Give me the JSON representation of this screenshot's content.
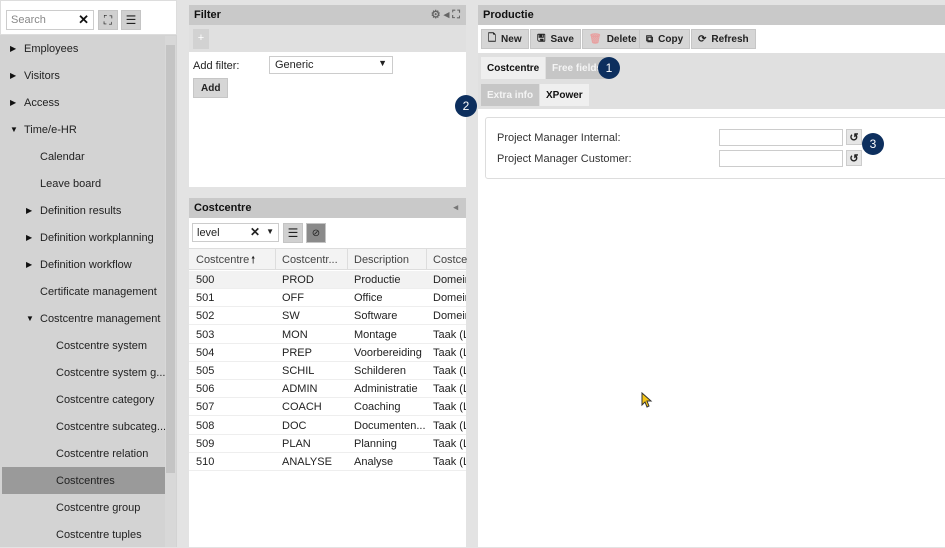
{
  "sidebar": {
    "search_placeholder": "Search",
    "items": [
      {
        "label": "Employees",
        "level": 0,
        "caret": "right"
      },
      {
        "label": "Visitors",
        "level": 0,
        "caret": "right"
      },
      {
        "label": "Access",
        "level": 0,
        "caret": "right"
      },
      {
        "label": "Time/e-HR",
        "level": 0,
        "caret": "down"
      },
      {
        "label": "Calendar",
        "level": 1,
        "caret": ""
      },
      {
        "label": "Leave board",
        "level": 1,
        "caret": ""
      },
      {
        "label": "Definition results",
        "level": 1,
        "caret": "right"
      },
      {
        "label": "Definition workplanning",
        "level": 1,
        "caret": "right"
      },
      {
        "label": "Definition workflow",
        "level": 1,
        "caret": "right"
      },
      {
        "label": "Certificate management",
        "level": 1,
        "caret": ""
      },
      {
        "label": "Costcentre management",
        "level": 1,
        "caret": "down"
      },
      {
        "label": "Costcentre system",
        "level": 2,
        "caret": ""
      },
      {
        "label": "Costcentre system g...",
        "level": 2,
        "caret": ""
      },
      {
        "label": "Costcentre category",
        "level": 2,
        "caret": ""
      },
      {
        "label": "Costcentre subcateg...",
        "level": 2,
        "caret": ""
      },
      {
        "label": "Costcentre relation",
        "level": 2,
        "caret": ""
      },
      {
        "label": "Costcentres",
        "level": 2,
        "caret": "",
        "selected": true
      },
      {
        "label": "Costcentre group",
        "level": 2,
        "caret": ""
      },
      {
        "label": "Costcentre tuples",
        "level": 2,
        "caret": ""
      }
    ]
  },
  "filter": {
    "title": "Filter",
    "add_plus": "+",
    "add_filter_label": "Add filter:",
    "select_value": "Generic",
    "add_button": "Add"
  },
  "costcentre": {
    "title": "Costcentre",
    "level_value": "level",
    "columns": [
      "Costcentre",
      "Costcentr...",
      "Description",
      "Costce"
    ],
    "rows": [
      [
        "500",
        "PROD",
        "Productie",
        "Domein"
      ],
      [
        "501",
        "OFF",
        "Office",
        "Domein"
      ],
      [
        "502",
        "SW",
        "Software",
        "Domein"
      ],
      [
        "503",
        "MON",
        "Montage",
        "Taak (Le"
      ],
      [
        "504",
        "PREP",
        "Voorbereiding",
        "Taak (Le"
      ],
      [
        "505",
        "SCHIL",
        "Schilderen",
        "Taak (Le"
      ],
      [
        "506",
        "ADMIN",
        "Administratie",
        "Taak (Le"
      ],
      [
        "507",
        "COACH",
        "Coaching",
        "Taak (Le"
      ],
      [
        "508",
        "DOC",
        "Documenten...",
        "Taak (Le"
      ],
      [
        "509",
        "PLAN",
        "Planning",
        "Taak (Le"
      ],
      [
        "510",
        "ANALYSE",
        "Analyse",
        "Taak (Le"
      ]
    ]
  },
  "detail": {
    "title": "Productie",
    "toolbar": {
      "new": "New",
      "save": "Save",
      "delete": "Delete",
      "copy": "Copy",
      "refresh": "Refresh"
    },
    "tabs": [
      "Costcentre",
      "Free fields"
    ],
    "subtabs": [
      "Extra info",
      "XPower"
    ],
    "fields": [
      {
        "label": "Project Manager Internal:",
        "value": ""
      },
      {
        "label": "Project Manager Customer:",
        "value": ""
      }
    ]
  },
  "badges": [
    "1",
    "2",
    "3"
  ],
  "colors": {
    "badge": "#0d2f5e",
    "selected_item": "#9a9a9a"
  }
}
